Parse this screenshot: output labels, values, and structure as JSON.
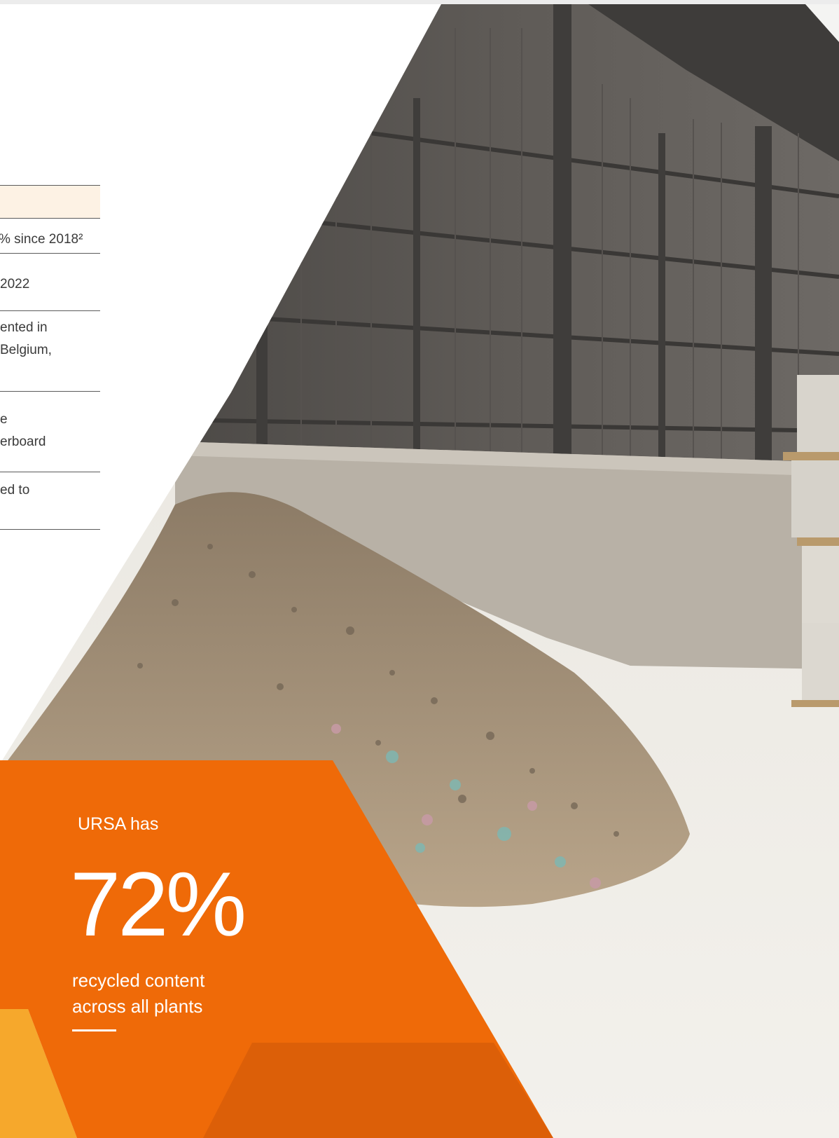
{
  "table": {
    "rows": [
      {
        "lines": [
          "% since 2018²"
        ]
      },
      {
        "lines": [
          "2022"
        ]
      },
      {
        "lines": [
          "ented in",
          "Belgium,"
        ]
      },
      {
        "lines": [
          "e",
          "erboard"
        ]
      },
      {
        "lines": [
          "ed to"
        ]
      }
    ]
  },
  "stat": {
    "intro": "URSA has",
    "value": "72%",
    "line1": "recycled content",
    "line2": "across all plants"
  },
  "colors": {
    "orange": "#ef6a08",
    "orange_dark": "#dc5f08",
    "orange_light": "#f6a82c",
    "table_header_bg": "#fdf2e4"
  }
}
